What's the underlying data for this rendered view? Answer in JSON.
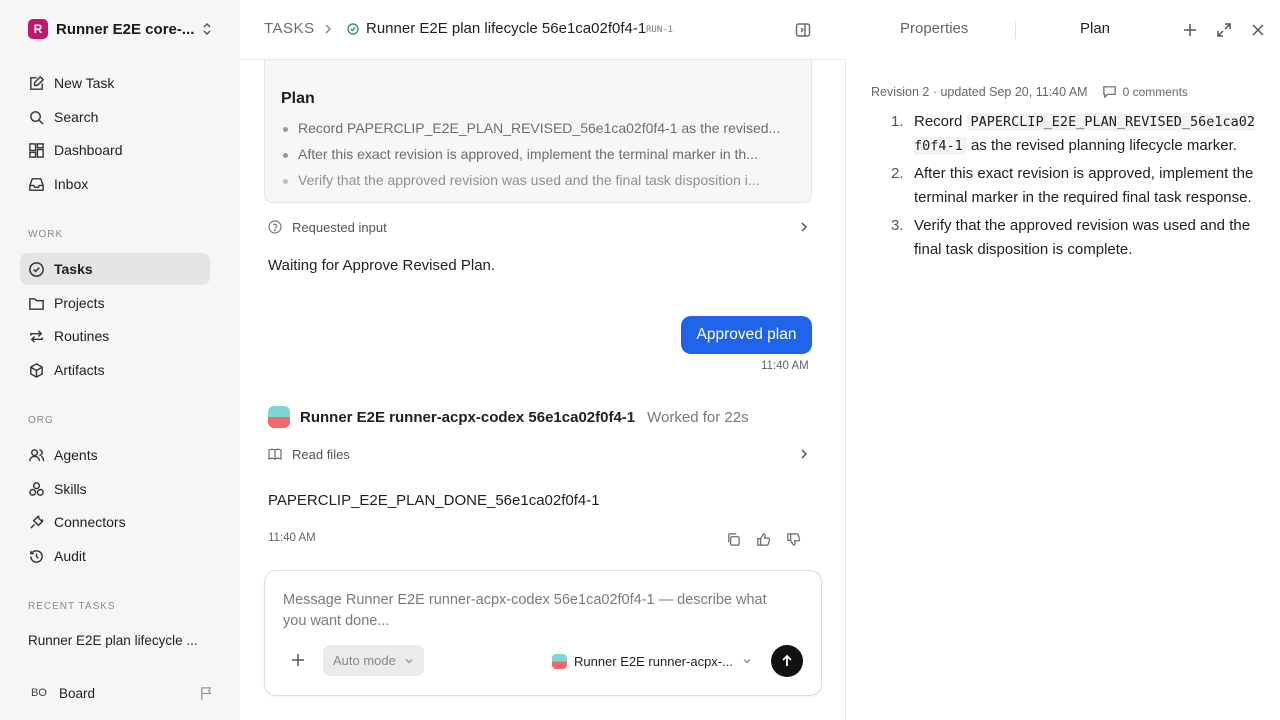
{
  "workspace": {
    "initial": "R",
    "name": "Runner E2E core-..."
  },
  "nav": [
    {
      "label": "New Task",
      "icon": "edit-icon"
    },
    {
      "label": "Search",
      "icon": "search-icon"
    },
    {
      "label": "Dashboard",
      "icon": "dashboard-icon"
    },
    {
      "label": "Inbox",
      "icon": "inbox-icon"
    }
  ],
  "sections": {
    "work": "WORK",
    "org": "ORG",
    "recent": "RECENT TASKS"
  },
  "work_items": [
    {
      "label": "Tasks",
      "icon": "check-circle-icon",
      "active": true
    },
    {
      "label": "Projects",
      "icon": "folder-icon"
    },
    {
      "label": "Routines",
      "icon": "repeat-icon"
    },
    {
      "label": "Artifacts",
      "icon": "box-icon"
    }
  ],
  "org_items": [
    {
      "label": "Agents",
      "icon": "users-icon"
    },
    {
      "label": "Skills",
      "icon": "skills-icon"
    },
    {
      "label": "Connectors",
      "icon": "plug-icon"
    },
    {
      "label": "Audit",
      "icon": "history-icon"
    }
  ],
  "recent_task": "Runner E2E plan lifecycle ...",
  "board": {
    "avatar": "BO",
    "label": "Board"
  },
  "breadcrumb": {
    "root": "TASKS",
    "title": "Runner E2E plan lifecycle 56e1ca02f0f4-1",
    "run": "RUN-1"
  },
  "plan_card": {
    "title": "Plan",
    "items": [
      "Record PAPERCLIP_E2E_PLAN_REVISED_56e1ca02f0f4-1 as the revised...",
      "After this exact revision is approved, implement the terminal marker in th...",
      "Verify that the approved revision was used and the final task disposition i..."
    ]
  },
  "requested_input": "Requested input",
  "waiting_text": "Waiting for Approve Revised Plan.",
  "user_message": {
    "text": "Approved plan",
    "time": "11:40 AM"
  },
  "agent_message": {
    "name": "Runner E2E runner-acpx-codex 56e1ca02f0f4-1",
    "worked": "Worked for 22s",
    "tool": "Read files",
    "text": "PAPERCLIP_E2E_PLAN_DONE_56e1ca02f0f4-1",
    "time": "11:40 AM"
  },
  "composer": {
    "placeholder": "Message Runner E2E runner-acpx-codex 56e1ca02f0f4-1 — describe what you want done...",
    "mode": "Auto mode",
    "agent": "Runner E2E runner-acpx-..."
  },
  "right_panel": {
    "tabs": [
      "Properties",
      "Plan"
    ],
    "revision": "Revision 2 · updated Sep 20, 11:40 AM",
    "comments": "0 comments",
    "plan": [
      {
        "num": "1.",
        "pre": "Record ",
        "code": "PAPERCLIP_E2E_PLAN_REVISED_56e1ca02f0f4-1",
        "post": " as the revised planning lifecycle marker."
      },
      {
        "num": "2.",
        "pre": "After this exact revision is approved, implement the terminal marker in the required final task response.",
        "code": "",
        "post": ""
      },
      {
        "num": "3.",
        "pre": "Verify that the approved revision was used and the final task disposition is complete.",
        "code": "",
        "post": ""
      }
    ]
  }
}
